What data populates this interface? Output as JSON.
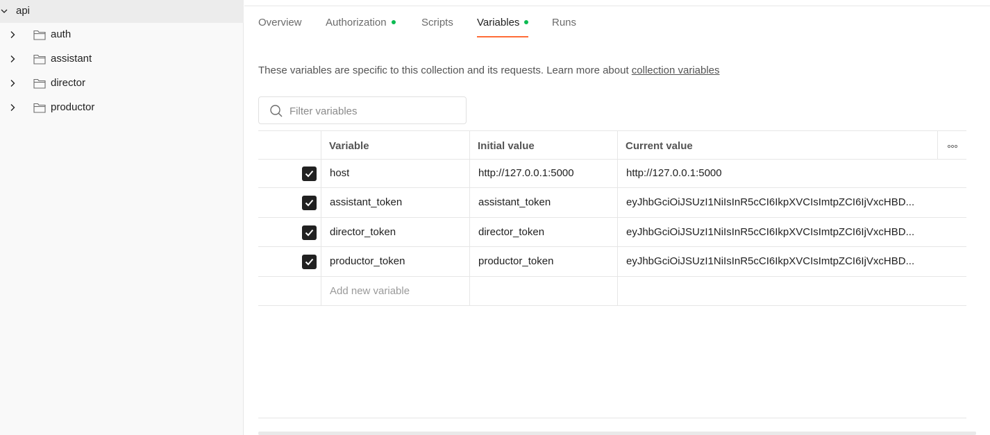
{
  "sidebar": {
    "root": {
      "label": "api",
      "icon": "chevron-down-icon"
    },
    "items": [
      {
        "label": "auth",
        "icon": "folder-icon"
      },
      {
        "label": "assistant",
        "icon": "folder-icon"
      },
      {
        "label": "director",
        "icon": "folder-icon"
      },
      {
        "label": "productor",
        "icon": "folder-icon"
      }
    ]
  },
  "tabs": [
    {
      "label": "Overview",
      "dot": false
    },
    {
      "label": "Authorization",
      "dot": true
    },
    {
      "label": "Scripts",
      "dot": false
    },
    {
      "label": "Variables",
      "dot": true,
      "active": true
    },
    {
      "label": "Runs",
      "dot": false
    }
  ],
  "description": {
    "text": "These variables are specific to this collection and its requests. Learn more about ",
    "link": "collection variables"
  },
  "filter": {
    "placeholder": "Filter variables",
    "value": ""
  },
  "table": {
    "headers": {
      "variable": "Variable",
      "initial": "Initial value",
      "current": "Current value"
    },
    "rows": [
      {
        "checked": true,
        "variable": "host",
        "initial": "http://127.0.0.1:5000",
        "current": "http://127.0.0.1:5000"
      },
      {
        "checked": true,
        "variable": "assistant_token",
        "initial": "assistant_token",
        "current": "eyJhbGciOiJSUzI1NiIsInR5cCI6IkpXVCIsImtpZCI6IjVxcHBD..."
      },
      {
        "checked": true,
        "variable": "director_token",
        "initial": "director_token",
        "current": "eyJhbGciOiJSUzI1NiIsInR5cCI6IkpXVCIsImtpZCI6IjVxcHBD..."
      },
      {
        "checked": true,
        "variable": "productor_token",
        "initial": "productor_token",
        "current": "eyJhbGciOiJSUzI1NiIsInR5cCI6IkpXVCIsImtpZCI6IjVxcHBD..."
      }
    ],
    "add_placeholder": "Add new variable"
  },
  "colors": {
    "accent": "#ff6c37",
    "status_dot": "#0cbb52",
    "checkbox": "#212121"
  }
}
